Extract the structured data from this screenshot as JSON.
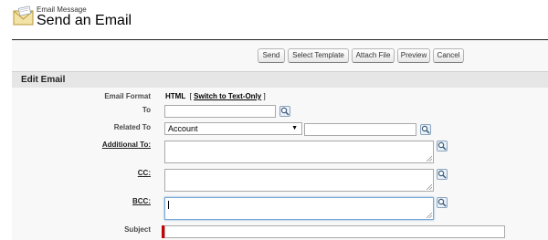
{
  "header": {
    "subtitle": "Email Message",
    "title": "Send an Email",
    "icon": "envelope-icon"
  },
  "buttons": {
    "send": "Send",
    "select_template": "Select Template",
    "attach_file": "Attach File",
    "preview": "Preview",
    "cancel": "Cancel"
  },
  "section": {
    "title": "Edit Email"
  },
  "form": {
    "email_format_label": "Email Format",
    "email_format_value": "HTML",
    "email_format_bracket_open": "[",
    "email_format_switch": "Switch to Text-Only",
    "email_format_bracket_close": "]",
    "to_label": "To",
    "to_value": "",
    "related_to_label": "Related To",
    "related_to_type": "Account",
    "related_to_value": "",
    "additional_to_label": "Additional To:",
    "additional_to_value": "",
    "cc_label": "CC:",
    "cc_value": "",
    "bcc_label": "BCC:",
    "bcc_value": "",
    "subject_label": "Subject",
    "subject_value": ""
  },
  "colors": {
    "required": "#cc0000",
    "focus": "#7aa7d6",
    "section_bg": "#e6e6e6"
  }
}
